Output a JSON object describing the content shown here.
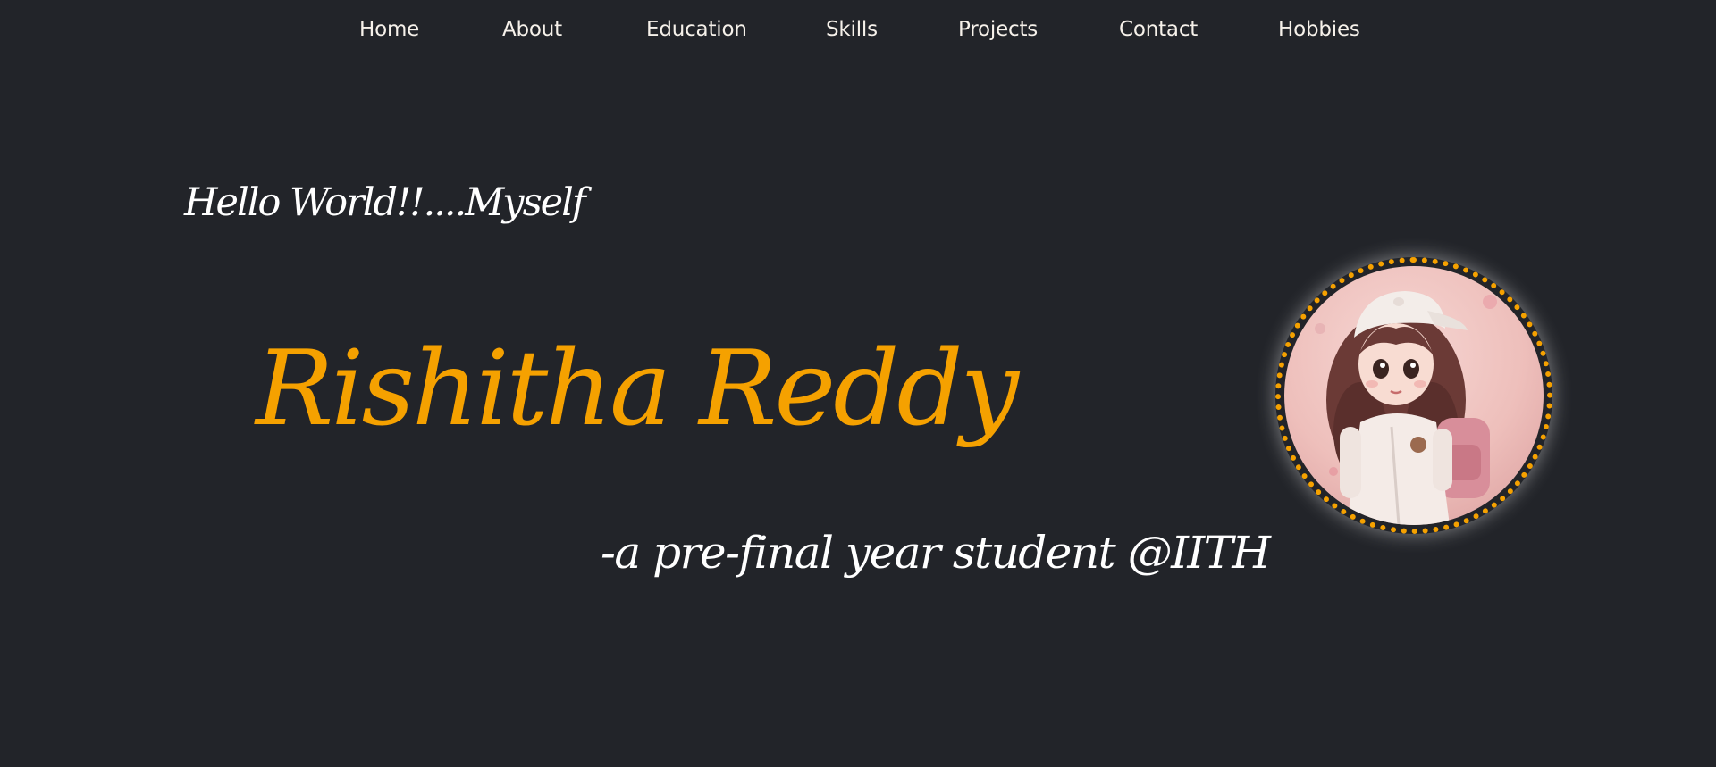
{
  "nav": {
    "items": [
      {
        "label": "Home"
      },
      {
        "label": "About"
      },
      {
        "label": "Education"
      },
      {
        "label": "Skills"
      },
      {
        "label": "Projects"
      },
      {
        "label": "Contact"
      },
      {
        "label": "Hobbies"
      }
    ]
  },
  "hero": {
    "greeting": "Hello World!!....Myself",
    "name": "Rishitha Reddy",
    "tagline": "-a pre-final year student @IITH",
    "avatar_icon": "girl-avatar-illustration"
  },
  "colors": {
    "background": "#222429",
    "accent": "#f5a100",
    "text": "#ffffff"
  }
}
